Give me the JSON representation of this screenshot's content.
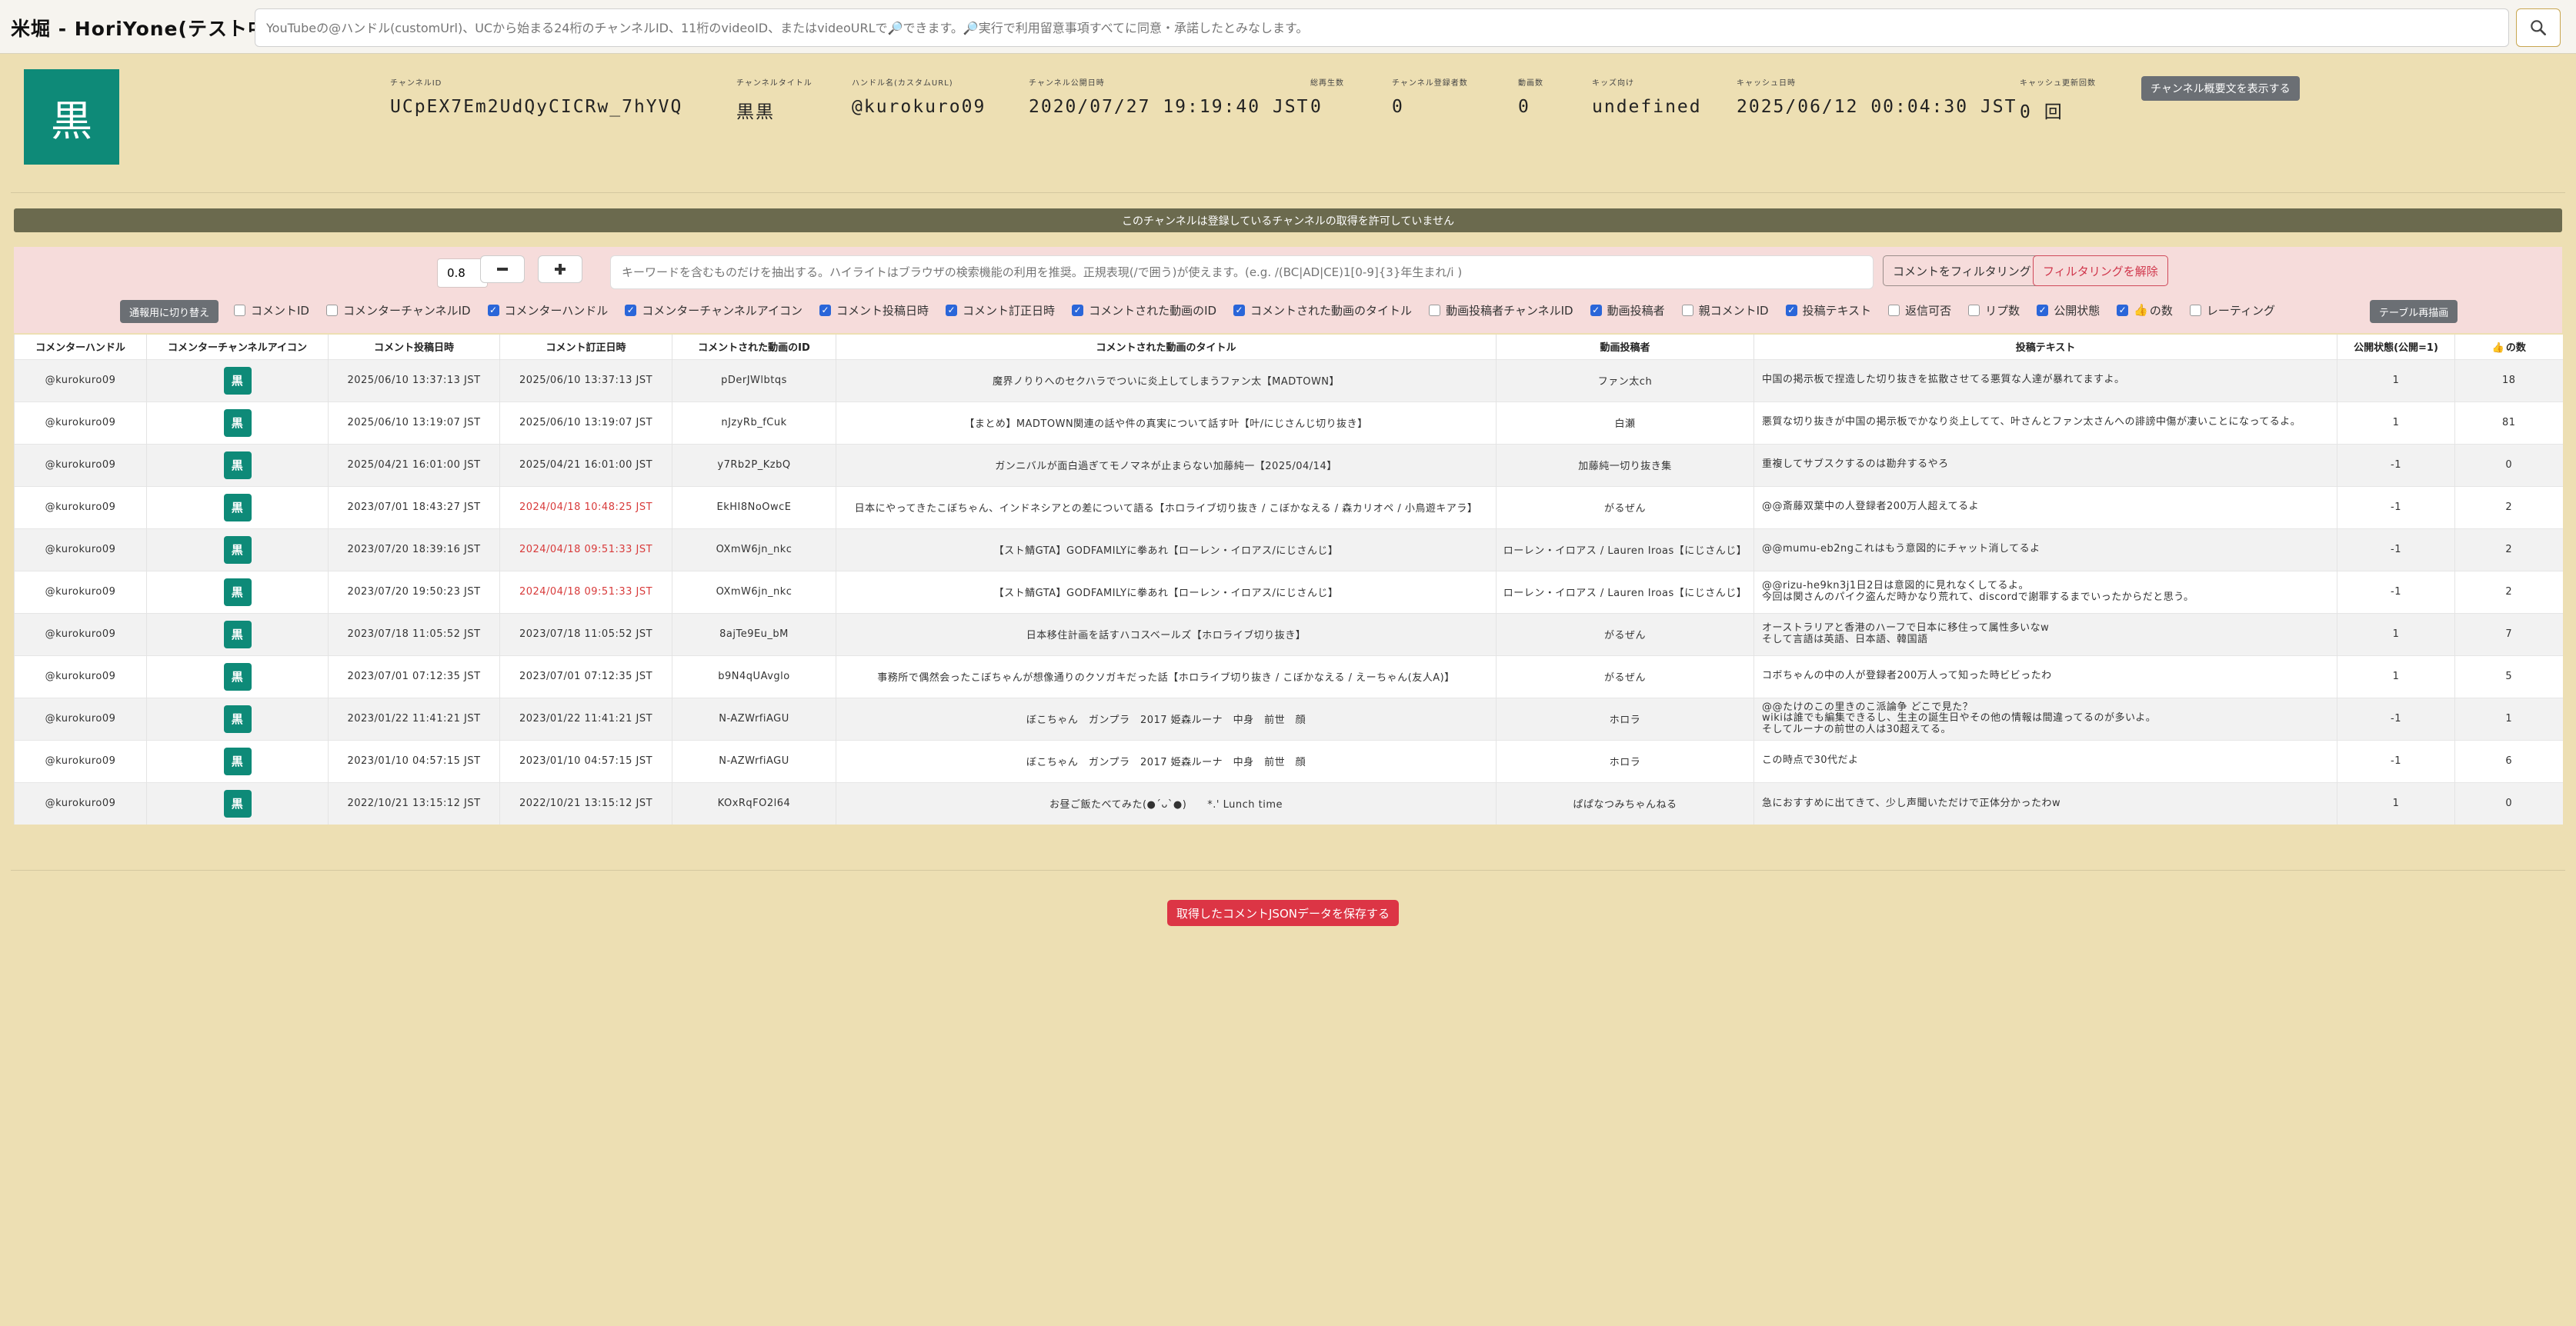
{
  "app": {
    "title": "米堀 - HoriYone(テスト中)",
    "search_placeholder": "YouTubeの@ハンドル(customUrl)、UCから始まる24桁のチャンネルID、11桁のvideoID、またはvideoURLで🔎できます。🔎実行で利用留意事項すべてに同意・承諾したとみなします。"
  },
  "channel": {
    "avatar_text": "黒",
    "fields": [
      {
        "label": "チャンネルID",
        "value": "UCpEX7Em2UdQyCICRw_7hYVQ"
      },
      {
        "label": "チャンネルタイトル",
        "value": "黒黒"
      },
      {
        "label": "ハンドル名(カスタムURL)",
        "value": "@kurokuro09"
      },
      {
        "label": "チャンネル公開日時",
        "value": "2020/07/27 19:19:40 JST"
      },
      {
        "label": "総再生数",
        "value": "0"
      },
      {
        "label": "チャンネル登録者数",
        "value": "0"
      },
      {
        "label": "動画数",
        "value": "0"
      },
      {
        "label": "キッズ向け",
        "value": "undefined"
      },
      {
        "label": "キャッシュ日時",
        "value": "2025/06/12 00:04:30 JST"
      },
      {
        "label": "キャッシュ更新回数",
        "value": "0 回"
      }
    ],
    "description_button": "チャンネル概要文を表示する"
  },
  "notice": "このチャンネルは登録しているチャンネルの取得を許可していません",
  "filter": {
    "zoom_value": "0.8",
    "minus_icon": "minus-icon",
    "plus_icon": "plus-icon",
    "keyword_placeholder": "キーワードを含むものだけを抽出する。ハイライトはブラウザの検索機能の利用を推奨。正規表現(/で囲う)が使えます。(e.g. /(BC|AD|CE)1[0-9]{3}年生まれ/i )",
    "filter_button": "コメントをフィルタリング",
    "clear_button": "フィルタリングを解除",
    "notify_button": "通報用に切り替え",
    "redraw_button": "テーブル再描画",
    "checkboxes": [
      {
        "label": "コメントID",
        "checked": false
      },
      {
        "label": "コメンターチャンネルID",
        "checked": false
      },
      {
        "label": "コメンターハンドル",
        "checked": true
      },
      {
        "label": "コメンターチャンネルアイコン",
        "checked": true
      },
      {
        "label": "コメント投稿日時",
        "checked": true
      },
      {
        "label": "コメント訂正日時",
        "checked": true
      },
      {
        "label": "コメントされた動画のID",
        "checked": true
      },
      {
        "label": "コメントされた動画のタイトル",
        "checked": true
      },
      {
        "label": "動画投稿者チャンネルID",
        "checked": false
      },
      {
        "label": "動画投稿者",
        "checked": true
      },
      {
        "label": "親コメントID",
        "checked": false
      },
      {
        "label": "投稿テキスト",
        "checked": true
      },
      {
        "label": "返信可否",
        "checked": false
      },
      {
        "label": "リプ数",
        "checked": false
      },
      {
        "label": "公開状態",
        "checked": true
      },
      {
        "label": "の数",
        "checked": true,
        "icon": "thumbs-up-icon"
      },
      {
        "label": "レーティング",
        "checked": false
      }
    ]
  },
  "table": {
    "headers": [
      "コメンターハンドル",
      "コメンターチャンネルアイコン",
      "コメント投稿日時",
      "コメント訂正日時",
      "コメントされた動画のID",
      "コメントされた動画のタイトル",
      "動画投稿者",
      "投稿テキスト",
      "公開状態(公開=1)",
      "の数"
    ],
    "like_header_icon": "thumbs-up-icon",
    "rows": [
      {
        "handle": "@kurokuro09",
        "icon": "黒",
        "posted": "2025/06/10 13:37:13 JST",
        "edited": "2025/06/10 13:37:13 JST",
        "edited_red": false,
        "video_id": "pDerJWlbtqs",
        "title": "魔界ノりりへのセクハラでついに炎上してしまうファン太【MADTOWN】",
        "uploader": "ファン太ch",
        "text": "中国の掲示板で捏造した切り抜きを拡散させてる悪質な人達が暴れてますよ。",
        "status": "1",
        "likes": "18"
      },
      {
        "handle": "@kurokuro09",
        "icon": "黒",
        "posted": "2025/06/10 13:19:07 JST",
        "edited": "2025/06/10 13:19:07 JST",
        "edited_red": false,
        "video_id": "nJzyRb_fCuk",
        "title": "【まとめ】MADTOWN関連の話や件の真実について話す叶【叶/にじさんじ切り抜き】",
        "uploader": "白瀬",
        "text": "悪質な切り抜きが中国の掲示板でかなり炎上してて、叶さんとファン太さんへの誹謗中傷が凄いことになってるよ。",
        "status": "1",
        "likes": "81"
      },
      {
        "handle": "@kurokuro09",
        "icon": "黒",
        "posted": "2025/04/21 16:01:00 JST",
        "edited": "2025/04/21 16:01:00 JST",
        "edited_red": false,
        "video_id": "y7Rb2P_KzbQ",
        "title": "ガンニバルが面白過ぎてモノマネが止まらない加藤純一【2025/04/14】",
        "uploader": "加藤純一切り抜き集",
        "text": "重複してサブスクするのは勘弁するやろ",
        "status": "-1",
        "likes": "0"
      },
      {
        "handle": "@kurokuro09",
        "icon": "黒",
        "posted": "2023/07/01 18:43:27 JST",
        "edited": "2024/04/18 10:48:25 JST",
        "edited_red": true,
        "video_id": "EkHI8NoOwcE",
        "title": "日本にやってきたこぼちゃん、インドネシアとの差について語る【ホロライブ切り抜き / こぼかなえる / 森カリオペ / 小鳥遊キアラ】",
        "uploader": "がるぜん",
        "text": "@@斎藤双葉中の人登録者200万人超えてるよ",
        "status": "-1",
        "likes": "2"
      },
      {
        "handle": "@kurokuro09",
        "icon": "黒",
        "posted": "2023/07/20 18:39:16 JST",
        "edited": "2024/04/18 09:51:33 JST",
        "edited_red": true,
        "video_id": "OXmW6jn_nkc",
        "title": "【スト鯖GTA】GODFAMILYに拳あれ【ローレン・イロアス/にじさんじ】",
        "uploader": "ローレン・イロアス / Lauren Iroas【にじさんじ】",
        "text": "@@mumu-eb2ngこれはもう意図的にチャット消してるよ",
        "status": "-1",
        "likes": "2"
      },
      {
        "handle": "@kurokuro09",
        "icon": "黒",
        "posted": "2023/07/20 19:50:23 JST",
        "edited": "2024/04/18 09:51:33 JST",
        "edited_red": true,
        "video_id": "OXmW6jn_nkc",
        "title": "【スト鯖GTA】GODFAMILYに拳あれ【ローレン・イロアス/にじさんじ】",
        "uploader": "ローレン・イロアス / Lauren Iroas【にじさんじ】",
        "text": "@@rizu-he9kn3j1日2日は意図的に見れなくしてるよ。\n今回は関さんのパイク盗んだ時かなり荒れて、discordで謝罪するまでいったからだと思う。",
        "status": "-1",
        "likes": "2"
      },
      {
        "handle": "@kurokuro09",
        "icon": "黒",
        "posted": "2023/07/18 11:05:52 JST",
        "edited": "2023/07/18 11:05:52 JST",
        "edited_red": false,
        "video_id": "8ajTe9Eu_bM",
        "title": "日本移住計画を話すハコスベールズ【ホロライブ切り抜き】",
        "uploader": "がるぜん",
        "text": "オーストラリアと香港のハーフで日本に移住って属性多いなw\nそして言語は英語、日本語、韓国語",
        "status": "1",
        "likes": "7"
      },
      {
        "handle": "@kurokuro09",
        "icon": "黒",
        "posted": "2023/07/01 07:12:35 JST",
        "edited": "2023/07/01 07:12:35 JST",
        "edited_red": false,
        "video_id": "b9N4qUAvglo",
        "title": "事務所で偶然会ったこぼちゃんが想像通りのクソガキだった話【ホロライブ切り抜き / こぼかなえる / えーちゃん(友人A)】",
        "uploader": "がるぜん",
        "text": "コボちゃんの中の人が登録者200万人って知った時ビビったわ",
        "status": "1",
        "likes": "5"
      },
      {
        "handle": "@kurokuro09",
        "icon": "黒",
        "posted": "2023/01/22 11:41:21 JST",
        "edited": "2023/01/22 11:41:21 JST",
        "edited_red": false,
        "video_id": "N-AZWrfiAGU",
        "title": "ぼこちゃん　ガンプラ　2017 姫森ルーナ　中身　前世　顔",
        "uploader": "ホロラ",
        "text": "@@たけのこの里きのこ派論争 どこで見た？\nwikiは誰でも編集できるし、生主の誕生日やその他の情報は間違ってるのが多いよ。\nそしてルーナの前世の人は30超えてる。",
        "status": "-1",
        "likes": "1"
      },
      {
        "handle": "@kurokuro09",
        "icon": "黒",
        "posted": "2023/01/10 04:57:15 JST",
        "edited": "2023/01/10 04:57:15 JST",
        "edited_red": false,
        "video_id": "N-AZWrfiAGU",
        "title": "ぼこちゃん　ガンプラ　2017 姫森ルーナ　中身　前世　顔",
        "uploader": "ホロラ",
        "text": "この時点で30代だよ",
        "status": "-1",
        "likes": "6"
      },
      {
        "handle": "@kurokuro09",
        "icon": "黒",
        "posted": "2022/10/21 13:15:12 JST",
        "edited": "2022/10/21 13:15:12 JST",
        "edited_red": false,
        "video_id": "KOxRqFO2l64",
        "title": "お昼ご飯たべてみた(●´ᴗ`●)　　*.' Lunch time",
        "uploader": "ぱぱなつみちゃんねる",
        "text": "急におすすめに出てきて、少し声聞いただけで正体分かったわw",
        "status": "1",
        "likes": "0"
      }
    ]
  },
  "save_button": "取得したコメントJSONデータを保存する",
  "colors": {
    "background": "#eddfb3",
    "avatar": "#0e8a78",
    "notice": "#6b6a4e",
    "filter_panel": "#f6dcdb",
    "danger": "#dc3545",
    "edited_red": "#d83a3a"
  }
}
